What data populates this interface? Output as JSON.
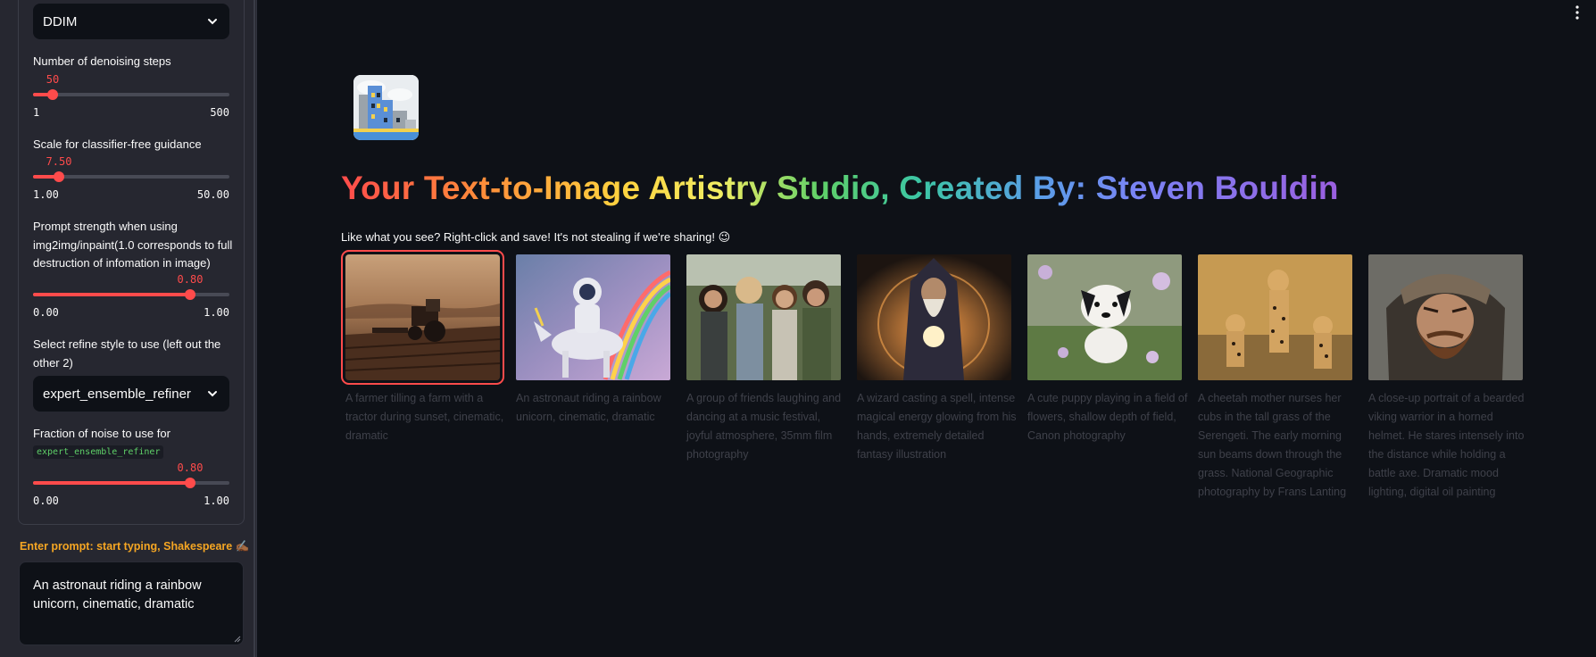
{
  "sidebar": {
    "scheduler": {
      "value": "DDIM"
    },
    "steps": {
      "label": "Number of denoising steps",
      "value": "50",
      "min": "1",
      "max": "500",
      "fraction": 0.098
    },
    "guidance": {
      "label": "Scale for classifier-free guidance",
      "value": "7.50",
      "min": "1.00",
      "max": "50.00",
      "fraction": 0.133
    },
    "prompt_strength": {
      "label": "Prompt strength when using img2img/inpaint(1.0 corresponds to full destruction of infomation in image)",
      "value": "0.80",
      "min": "0.00",
      "max": "1.00",
      "fraction": 0.8
    },
    "refine_style": {
      "label": "Select refine style to use (left out the other 2)",
      "value": "expert_ensemble_refiner"
    },
    "noise_fraction": {
      "label": "Fraction of noise to use for",
      "code": "expert_ensemble_refiner",
      "value": "0.80",
      "min": "0.00",
      "max": "1.00",
      "fraction": 0.8
    },
    "prompt": {
      "label": "Enter prompt: start typing, Shakespeare ✍🏾",
      "value": "An astronaut riding a rainbow unicorn, cinematic, dramatic"
    }
  },
  "main": {
    "title": "Your Text-to-Image Artistry Studio, Created By: Steven Bouldin",
    "subtitle": "Like what you see? Right-click and save! It's not stealing if we're sharing! 😉",
    "gallery": [
      {
        "caption": "A farmer tilling a farm with a tractor during sunset, cinematic, dramatic",
        "selected": true
      },
      {
        "caption": "An astronaut riding a rainbow unicorn, cinematic, dramatic",
        "selected": false
      },
      {
        "caption": "A group of friends laughing and dancing at a music festival, joyful atmosphere, 35mm film photography",
        "selected": false
      },
      {
        "caption": "A wizard casting a spell, intense magical energy glowing from his hands, extremely detailed fantasy illustration",
        "selected": false
      },
      {
        "caption": "A cute puppy playing in a field of flowers, shallow depth of field, Canon photography",
        "selected": false
      },
      {
        "caption": "A cheetah mother nurses her cubs in the tall grass of the Serengeti. The early morning sun beams down through the grass. National Geographic photography by Frans Lanting",
        "selected": false
      },
      {
        "caption": "A close-up portrait of a bearded viking warrior in a horned helmet. He stares intensely into the distance while holding a battle axe. Dramatic mood lighting, digital oil painting",
        "selected": false
      }
    ]
  },
  "colors": {
    "accent": "#ff4b4b",
    "background": "#0e1117",
    "sidebar": "#262730",
    "prompt_label": "#f5a623"
  },
  "icons": {
    "select_chevron": "chevron-down-icon",
    "menu": "more-vertical-icon",
    "logo": "city-buildings-icon"
  }
}
